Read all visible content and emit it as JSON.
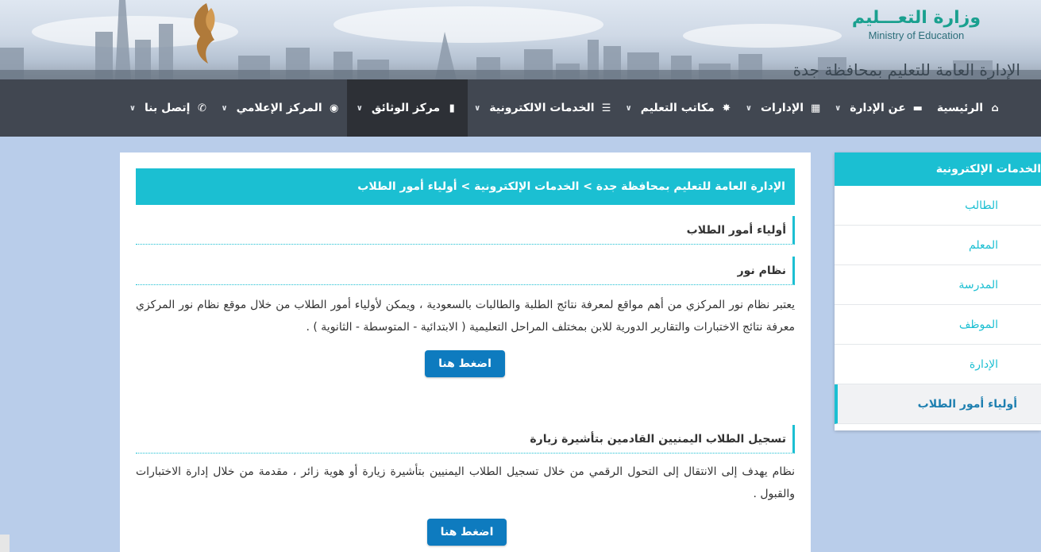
{
  "header": {
    "ministry_ar": "وزارة التعـــليم",
    "ministry_en": "Ministry of Education",
    "directorate": "الإدارة العامة للتعليم بمحافظة جدة",
    "logo_icon": "award-logo-icon"
  },
  "nav": {
    "items": [
      {
        "label": "الرئيسية",
        "icon": "home-icon",
        "glyph": "⌂"
      },
      {
        "label": "عن الإدارة",
        "icon": "presentation-icon",
        "glyph": "▬"
      },
      {
        "label": "الإدارات",
        "icon": "grid-icon",
        "glyph": "▦"
      },
      {
        "label": "مكاتب التعليم",
        "icon": "asterisk-icon",
        "glyph": "✸"
      },
      {
        "label": "الخدمات الالكترونية",
        "icon": "list-icon",
        "glyph": "☰"
      },
      {
        "label": "مركز الوثائق",
        "icon": "document-icon",
        "glyph": "▮"
      },
      {
        "label": "المركز الإعلامي",
        "icon": "eye-icon",
        "glyph": "◉"
      },
      {
        "label": "إتصل بنا",
        "icon": "phone-icon",
        "glyph": "✆"
      }
    ],
    "chevron": "∨"
  },
  "main": {
    "breadcrumb": "الإدارة العامة للتعليم بمحافظة جدة > الخدمات الإلكترونية > أولياء أمور الطلاب",
    "page_title": "أولياء أمور الطلاب",
    "noor": {
      "title": "نظام نور",
      "text": "يعتبر نظام نور المركزي من أهم مواقع لمعرفة نتائج الطلبة والطالبات بالسعودية ، ويمكن لأولياء أمور الطلاب من خلال موقع نظام نور المركزي معرفة نتائج الاختبارات والتقارير الدورية للابن بمختلف المراحل التعليمية ( الابتدائية - المتوسطة - الثانوية ) .",
      "button": "اضغط هنا"
    },
    "yemen": {
      "title": "تسجيل الطلاب اليمنيين القادمين بتأشيرة زيارة",
      "text": "نظام يهدف إلى الانتقال إلى التحول الرقمي من خلال تسجيل الطلاب اليمنيين بتأشيرة زيارة أو هوية زائر ، مقدمة من خلال إدارة الاختبارات والقبول .",
      "button": "اضغط هنا"
    }
  },
  "sidebar": {
    "title": "الخدمات الإلكترونية",
    "items": [
      {
        "label": "الطالب"
      },
      {
        "label": "المعلم"
      },
      {
        "label": "المدرسة"
      },
      {
        "label": "الموظف"
      },
      {
        "label": "الإدارة"
      },
      {
        "label": "أولياء أمور الطلاب"
      }
    ]
  },
  "colors": {
    "accent": "#1bbfd2",
    "nav_bg": "#414751",
    "button": "#0e7bbf",
    "page_bg": "#b9cdea"
  }
}
